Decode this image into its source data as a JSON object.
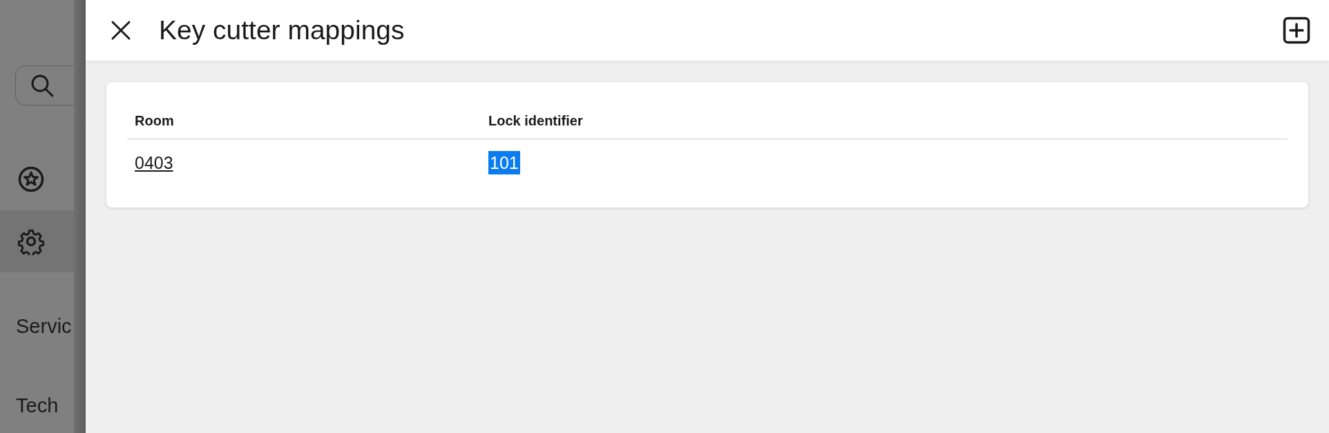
{
  "background": {
    "search": {
      "kind": "search"
    },
    "nav_items": [
      {
        "kind": "star",
        "selected": false
      },
      {
        "kind": "gear",
        "selected": true
      },
      {
        "kind": "text",
        "label": "Servic",
        "selected": false
      },
      {
        "kind": "text",
        "label": "Tech",
        "selected": false
      }
    ]
  },
  "drawer": {
    "title": "Key cutter mappings",
    "table": {
      "columns": [
        "Room",
        "Lock identifier"
      ],
      "rows": [
        {
          "room": "0403",
          "lock_identifier": "101",
          "lock_identifier_highlighted": true
        }
      ]
    }
  }
}
